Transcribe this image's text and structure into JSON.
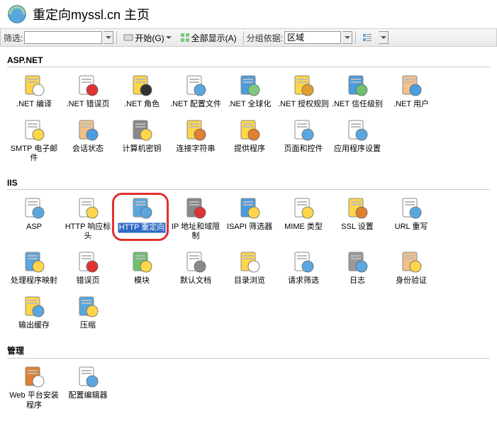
{
  "header": {
    "title": "重定向myssl.cn 主页"
  },
  "toolbar": {
    "filter_label": "筛选:",
    "start_label": "开始(G)",
    "show_all_label": "全部显示(A)",
    "group_by_label": "分组依据:",
    "group_by_value": "区域"
  },
  "sections": {
    "aspnet": {
      "title": "ASP.NET",
      "items": [
        {
          "name": "net-compile",
          "label": ".NET 编译"
        },
        {
          "name": "net-errorpages",
          "label": ".NET 错误页"
        },
        {
          "name": "net-roles",
          "label": ".NET 角色"
        },
        {
          "name": "net-config",
          "label": ".NET 配置文件"
        },
        {
          "name": "net-global",
          "label": ".NET 全球化"
        },
        {
          "name": "net-authrules",
          "label": ".NET 授权规则"
        },
        {
          "name": "net-trust",
          "label": ".NET 信任级别"
        },
        {
          "name": "net-users",
          "label": ".NET 用户"
        },
        {
          "name": "smtp",
          "label": "SMTP 电子邮件"
        },
        {
          "name": "session-state",
          "label": "会话状态"
        },
        {
          "name": "machine-key",
          "label": "计算机密钥"
        },
        {
          "name": "conn-strings",
          "label": "连接字符串"
        },
        {
          "name": "providers",
          "label": "提供程序"
        },
        {
          "name": "pages-controls",
          "label": "页面和控件"
        },
        {
          "name": "app-settings",
          "label": "应用程序设置"
        }
      ]
    },
    "iis": {
      "title": "IIS",
      "items": [
        {
          "name": "asp",
          "label": "ASP"
        },
        {
          "name": "http-response",
          "label": "HTTP 响应标头"
        },
        {
          "name": "http-redirect",
          "label": "HTTP 重定向",
          "selected": true,
          "highlighted": true
        },
        {
          "name": "ip-domain",
          "label": "IP 地址和域限制"
        },
        {
          "name": "isapi-filters",
          "label": "ISAPI 筛选器"
        },
        {
          "name": "mime",
          "label": "MIME 类型"
        },
        {
          "name": "ssl",
          "label": "SSL 设置"
        },
        {
          "name": "url-rewrite",
          "label": "URL 重写"
        },
        {
          "name": "handler-map",
          "label": "处理程序映射"
        },
        {
          "name": "error-pages",
          "label": "错误页"
        },
        {
          "name": "modules",
          "label": "模块"
        },
        {
          "name": "default-doc",
          "label": "默认文档"
        },
        {
          "name": "dir-browse",
          "label": "目录浏览"
        },
        {
          "name": "request-filter",
          "label": "请求筛选"
        },
        {
          "name": "logging",
          "label": "日志"
        },
        {
          "name": "auth",
          "label": "身份验证"
        },
        {
          "name": "output-cache",
          "label": "输出缓存"
        },
        {
          "name": "compression",
          "label": "压缩"
        }
      ]
    },
    "mgmt": {
      "title": "管理",
      "items": [
        {
          "name": "web-platform",
          "label": "Web 平台安装程序"
        },
        {
          "name": "config-editor",
          "label": "配置编辑器"
        }
      ]
    }
  },
  "icon_colors": {
    "net-compile": [
      "#ffd54a",
      "#fff"
    ],
    "net-errorpages": [
      "#fff",
      "#d33"
    ],
    "net-roles": [
      "#ffd54a",
      "#333"
    ],
    "net-config": [
      "#fff",
      "#5aa7e0"
    ],
    "net-global": [
      "#4a9de0",
      "#7fc97f"
    ],
    "net-authrules": [
      "#ffd54a",
      "#e0a030"
    ],
    "net-trust": [
      "#4a9de0",
      "#6fbf6f"
    ],
    "net-users": [
      "#f2c18a",
      "#4a9de0"
    ],
    "smtp": [
      "#fff",
      "#ffd54a"
    ],
    "session-state": [
      "#f2c18a",
      "#4a9de0"
    ],
    "machine-key": [
      "#888",
      "#ffd54a"
    ],
    "conn-strings": [
      "#ffd54a",
      "#e08030"
    ],
    "providers": [
      "#ffd54a",
      "#e08030"
    ],
    "pages-controls": [
      "#fff",
      "#5aa7e0"
    ],
    "app-settings": [
      "#fff",
      "#5aa7e0"
    ],
    "asp": [
      "#fff",
      "#5aa7e0"
    ],
    "http-response": [
      "#fff",
      "#ffd54a"
    ],
    "http-redirect": [
      "#5aa7e0",
      "#5aa7e0"
    ],
    "ip-domain": [
      "#888",
      "#d33"
    ],
    "isapi-filters": [
      "#4a9de0",
      "#ffd54a"
    ],
    "mime": [
      "#fff",
      "#ffd54a"
    ],
    "ssl": [
      "#ffd54a",
      "#e08030"
    ],
    "url-rewrite": [
      "#fff",
      "#5aa7e0"
    ],
    "handler-map": [
      "#5aa7e0",
      "#ffd54a"
    ],
    "error-pages": [
      "#fff",
      "#d33"
    ],
    "modules": [
      "#6fbf6f",
      "#ffd54a"
    ],
    "default-doc": [
      "#fff",
      "#888"
    ],
    "dir-browse": [
      "#ffd54a",
      "#fff"
    ],
    "request-filter": [
      "#fff",
      "#5aa7e0"
    ],
    "logging": [
      "#999",
      "#5aa7e0"
    ],
    "auth": [
      "#f2c18a",
      "#ffd54a"
    ],
    "output-cache": [
      "#ffd54a",
      "#5aa7e0"
    ],
    "compression": [
      "#5aa7e0",
      "#ffd54a"
    ],
    "web-platform": [
      "#e08030",
      "#fff"
    ],
    "config-editor": [
      "#fff",
      "#5aa7e0"
    ]
  }
}
